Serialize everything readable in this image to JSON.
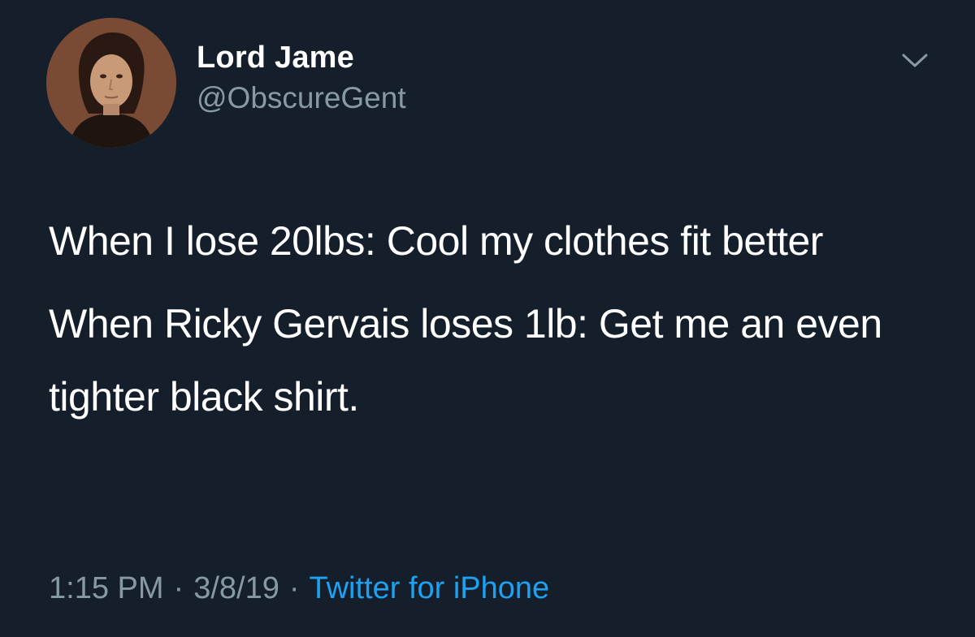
{
  "tweet": {
    "author": {
      "display_name": "Lord Jame",
      "handle": "@ObscureGent",
      "avatar_icon": "profile-photo"
    },
    "menu_icon": "chevron-down-icon",
    "paragraphs": [
      "When I lose 20lbs: Cool my clothes fit better",
      "When Ricky Gervais loses 1lb: Get me an even tighter black shirt."
    ],
    "meta": {
      "time": "1:15 PM",
      "separator": "·",
      "date": "3/8/19",
      "source": "Twitter for iPhone"
    }
  },
  "colors": {
    "background": "#151e2b",
    "text": "#ffffff",
    "secondary_text": "#8899a6",
    "link": "#1da1f2"
  }
}
